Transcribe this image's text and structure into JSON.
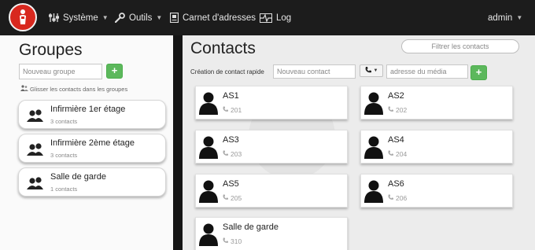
{
  "navbar": {
    "logo_icon": "app-logo-icon",
    "items": [
      {
        "label": "Système",
        "icon": "system-equalizer-icon",
        "has_caret": true
      },
      {
        "label": "Outils",
        "icon": "wrench-icon",
        "has_caret": true
      },
      {
        "label": "Carnet d'adresses",
        "icon": "address-book-icon",
        "has_caret": false
      },
      {
        "label": "Log",
        "icon": "pulse-log-icon",
        "has_caret": false
      }
    ],
    "user": "admin"
  },
  "groups_panel": {
    "title": "Groupes",
    "new_group_placeholder": "Nouveau groupe",
    "add_button": "+",
    "drag_hint": "Glisser les contacts dans les groupes",
    "groups": [
      {
        "name": "Infirmière 1er étage",
        "count": "3 contacts"
      },
      {
        "name": "Infirmière 2ème étage",
        "count": "3 contacts"
      },
      {
        "name": "Salle de garde",
        "count": "1 contacts"
      }
    ]
  },
  "contacts_panel": {
    "title": "Contacts",
    "filter_placeholder": "Filtrer les contacts",
    "quick_create_label": "Création de contact rapide",
    "new_contact_placeholder": "Nouveau contact",
    "media_placeholder": "adresse du média",
    "add_button": "+",
    "contacts": [
      {
        "name": "AS1",
        "number": "201"
      },
      {
        "name": "AS2",
        "number": "202"
      },
      {
        "name": "AS3",
        "number": "203"
      },
      {
        "name": "AS4",
        "number": "204"
      },
      {
        "name": "AS5",
        "number": "205"
      },
      {
        "name": "AS6",
        "number": "206"
      },
      {
        "name": "Salle de garde",
        "number": "310"
      }
    ]
  },
  "colors": {
    "navbar_bg": "#1c1c1c",
    "accent_green": "#5cb85c",
    "logo_red": "#d8281e"
  }
}
